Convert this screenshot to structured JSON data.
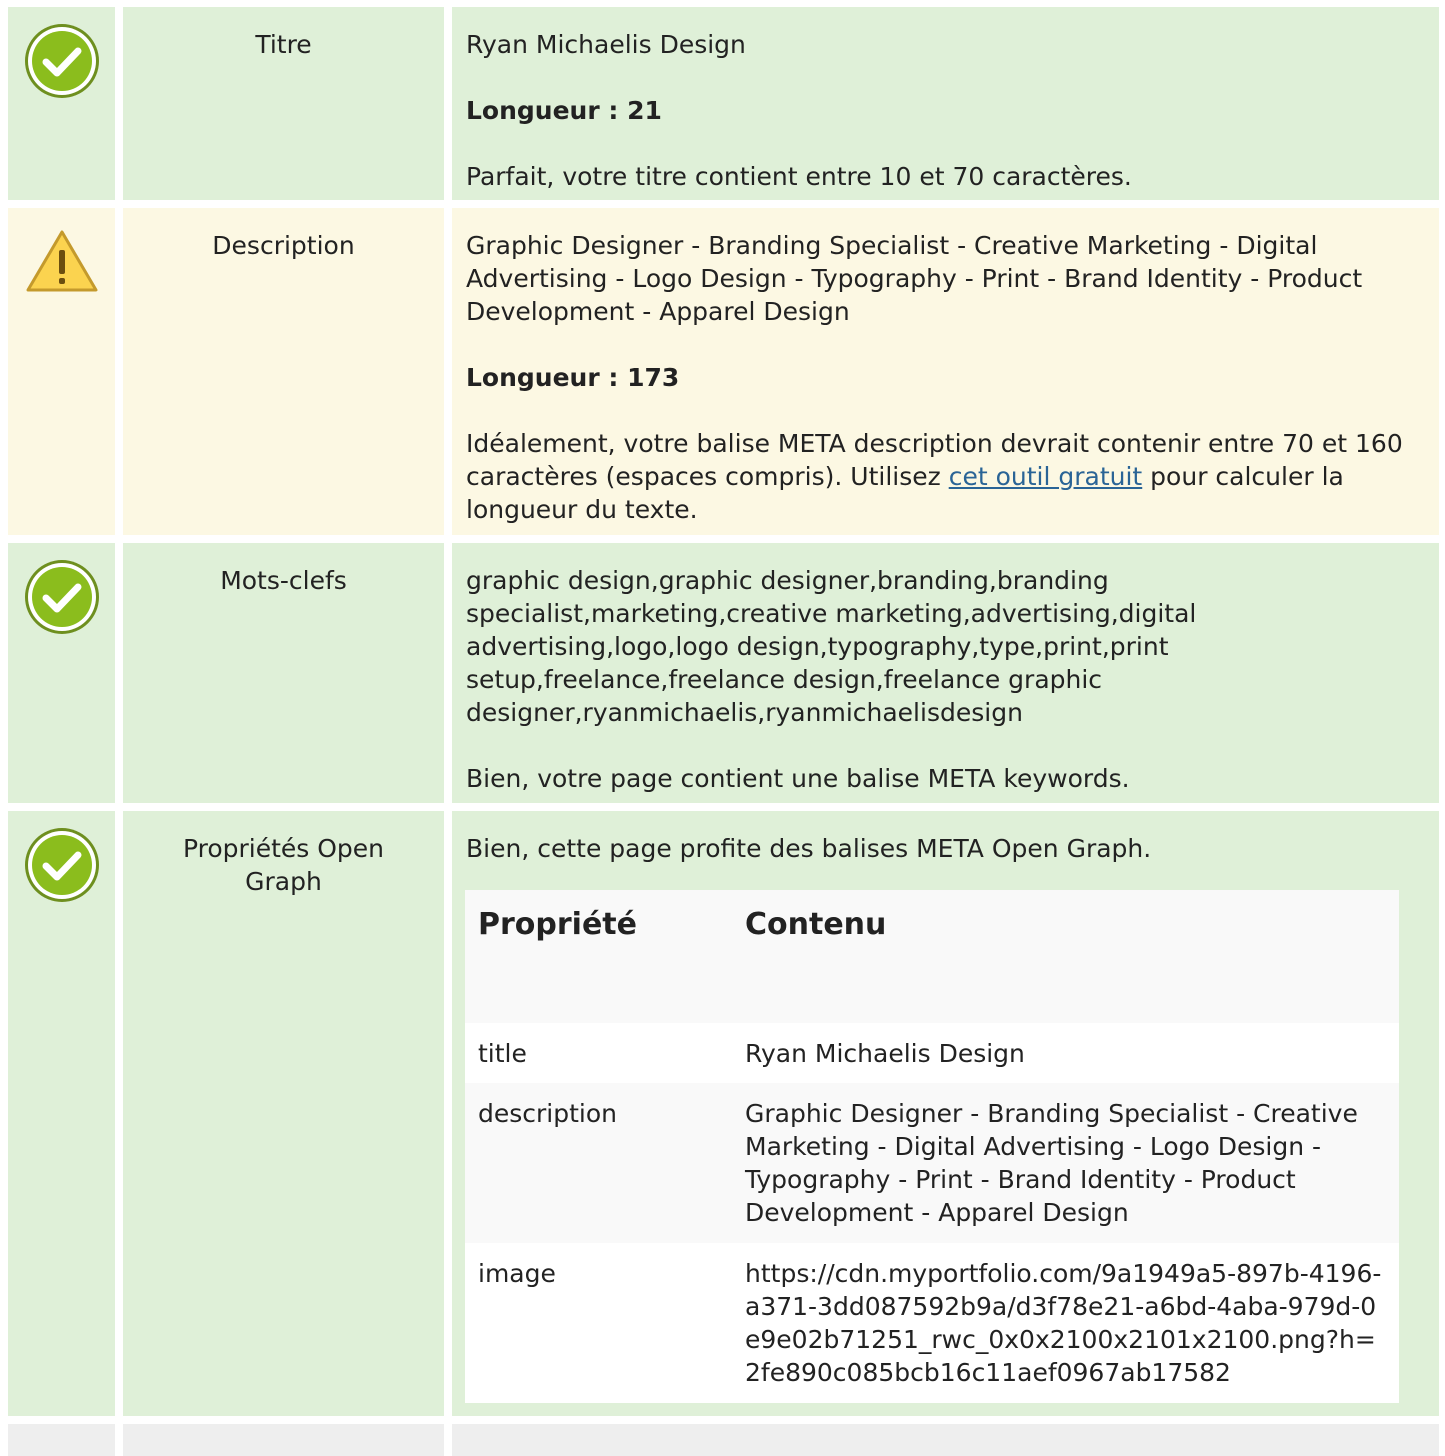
{
  "rows": [
    {
      "status": "ok",
      "label": "Titre",
      "value": "Ryan Michaelis Design",
      "length_label": "Longueur : 21",
      "message": "Parfait, votre titre contient entre 10 et 70 caractères."
    },
    {
      "status": "warning",
      "label": "Description",
      "value": "Graphic Designer - Branding Specialist - Creative Marketing - Digital Advertising - Logo Design - Typography - Print - Brand Identity - Product Development - Apparel Design",
      "length_label": "Longueur : 173",
      "message_before": "Idéalement, votre balise META description devrait contenir entre 70 et 160 caractères (espaces compris). Utilisez ",
      "message_link": "cet outil gratuit",
      "message_after": " pour calculer la longueur du texte."
    },
    {
      "status": "ok",
      "label": "Mots-clefs",
      "value": "graphic design,graphic designer,branding,branding specialist,marketing,creative marketing,advertising,digital advertising,logo,logo design,typography,type,print,print setup,freelance,freelance design,freelance graphic designer,ryanmichaelis,ryanmichaelisdesign",
      "message": "Bien, votre page contient une balise META keywords."
    },
    {
      "status": "ok",
      "label": "Propriétés Open Graph",
      "message": "Bien, cette page profite des balises META Open Graph.",
      "table": {
        "headers": [
          "Propriété",
          "Contenu"
        ],
        "rows": [
          {
            "property": "title",
            "content": "Ryan Michaelis Design"
          },
          {
            "property": "description",
            "content": "Graphic Designer - Branding Specialist - Creative Marketing - Digital Advertising - Logo Design - Typography - Print - Brand Identity - Product Development - Apparel Design"
          },
          {
            "property": "image",
            "content": "https://cdn.myportfolio.com/9a1949a5-897b-4196-a371-3dd087592b9a/d3f78e21-a6bd-4aba-979d-0e9e02b71251_rwc_0x0x2100x2101x2100.png?h=2fe890c085bcb16c11aef0967ab17582"
          }
        ]
      }
    }
  ],
  "colors": {
    "ok_bg": "#dff0d8",
    "warning_bg": "#fcf8e3",
    "link": "#2a6496"
  }
}
